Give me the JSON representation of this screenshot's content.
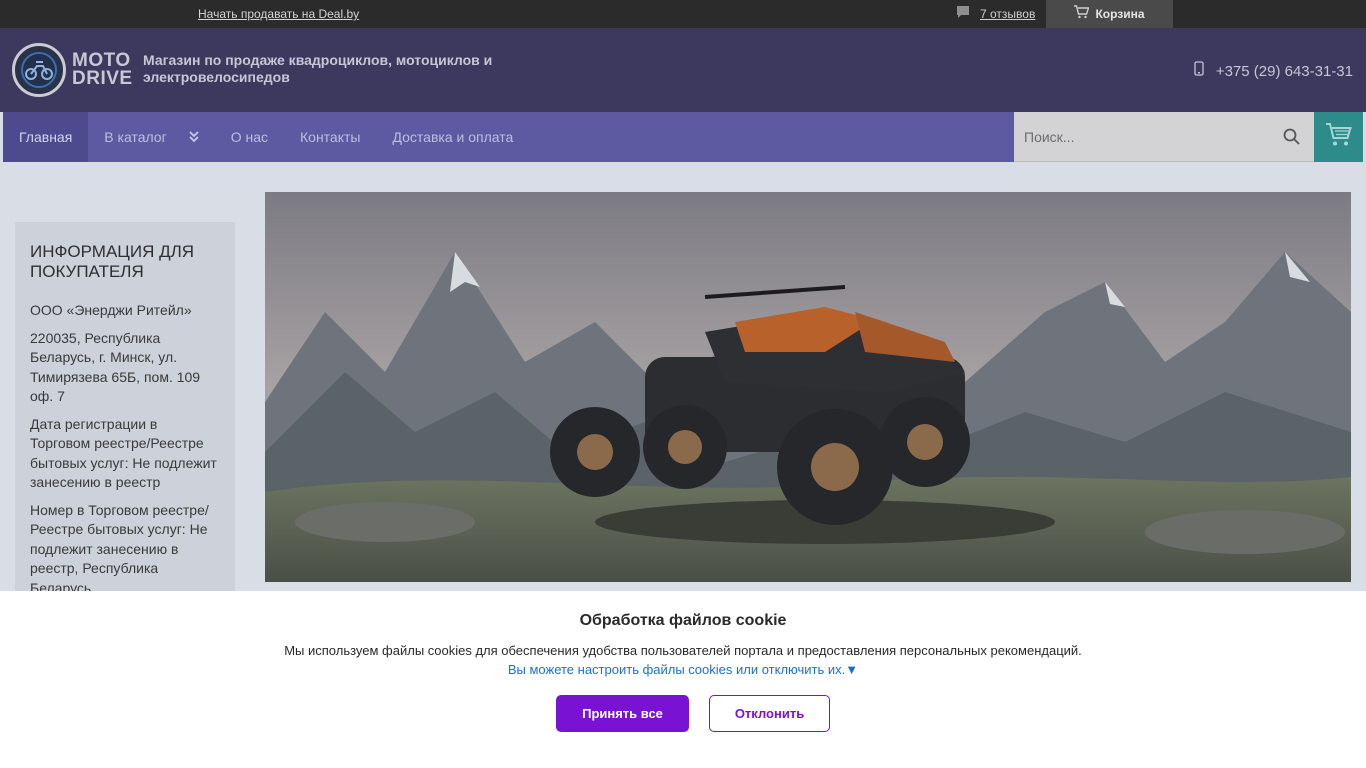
{
  "topbar": {
    "sell_link": "Начать продавать на Deal.by",
    "reviews": "7 отзывов",
    "cart": "Корзина",
    "reviews_icon": "chat-bubble-icon",
    "cart_icon": "cart-icon"
  },
  "header": {
    "logo_line1": "MOTO",
    "logo_line2": "DRIVE",
    "tagline": "Магазин по продаже квадроциклов, мотоциклов и электровелосипедов",
    "phone": "+375 (29) 643-31-31",
    "phone_icon": "mobile-phone-icon"
  },
  "nav": {
    "items": [
      {
        "label": "Главная"
      },
      {
        "label": "В каталог"
      },
      {
        "label": "О нас"
      },
      {
        "label": "Контакты"
      },
      {
        "label": "Доставка и оплата"
      }
    ],
    "search_placeholder": "Поиск...",
    "search_icon": "search-icon",
    "cart_icon": "cart-icon"
  },
  "sidebar": {
    "title": "ИНФОРМАЦИЯ ДЛЯ ПОКУПАТЕЛЯ",
    "items": [
      "ООО «Энерджи Ритейл»",
      "220035, Республика Беларусь, г. Минск, ул. Тимирязева 65Б, пом. 109 оф. 7",
      "Дата регистрации в Торговом реестре/Реестре бытовых услуг: Не подлежит занесению в реестр",
      "Номер в Торговом реестре/Реестре бытовых услуг: Не подлежит занесению в реестр, Республика Беларусь"
    ]
  },
  "cookie": {
    "title": "Обработка файлов cookie",
    "description": "Мы используем файлы cookies для обеспечения удобства пользователей портала и предоставления персональных рекомендаций.",
    "settings_link": "Вы можете настроить файлы cookies или отключить их.▼",
    "accept": "Принять все",
    "decline": "Отклонить"
  },
  "colors": {
    "header_bg": "#3d385e",
    "nav_bg": "#5e5aa2",
    "accent_purple": "#7a12d4",
    "cart_teal": "#2d8c89"
  }
}
